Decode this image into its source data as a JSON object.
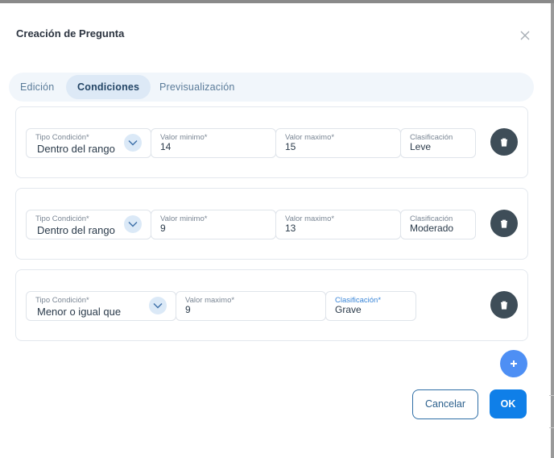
{
  "dialog": {
    "title": "Creación de Pregunta",
    "close_icon": "close-icon"
  },
  "tabs": [
    {
      "label": "Edición",
      "active": false
    },
    {
      "label": "Condiciones",
      "active": true
    },
    {
      "label": "Previsualización",
      "active": false
    }
  ],
  "conditions": [
    {
      "tipo_label": "Tipo Condición*",
      "tipo_value": "Dentro del rango",
      "min_label": "Valor minimo*",
      "min_value": "14",
      "max_label": "Valor maximo*",
      "max_value": "15",
      "clas_label": "Clasificación",
      "clas_value": "Leve"
    },
    {
      "tipo_label": "Tipo Condición*",
      "tipo_value": "Dentro del rango",
      "min_label": "Valor minimo*",
      "min_value": "9",
      "max_label": "Valor maximo*",
      "max_value": "13",
      "clas_label": "Clasificación",
      "clas_value": "Moderado"
    },
    {
      "tipo_label": "Tipo Condición*",
      "tipo_value": "Menor o igual que",
      "max_label": "Valor maximo*",
      "max_value": "9",
      "clas_label": "Clasificación*",
      "clas_value": "Grave"
    }
  ],
  "actions": {
    "cancel_label": "Cancelar",
    "ok_label": "OK"
  },
  "colors": {
    "primary": "#0f7fe8",
    "add_button": "#4e8ff4",
    "delete_button": "#3e4d58",
    "tab_bar": "#f1f6fb",
    "active_tab": "#dde9f6"
  }
}
